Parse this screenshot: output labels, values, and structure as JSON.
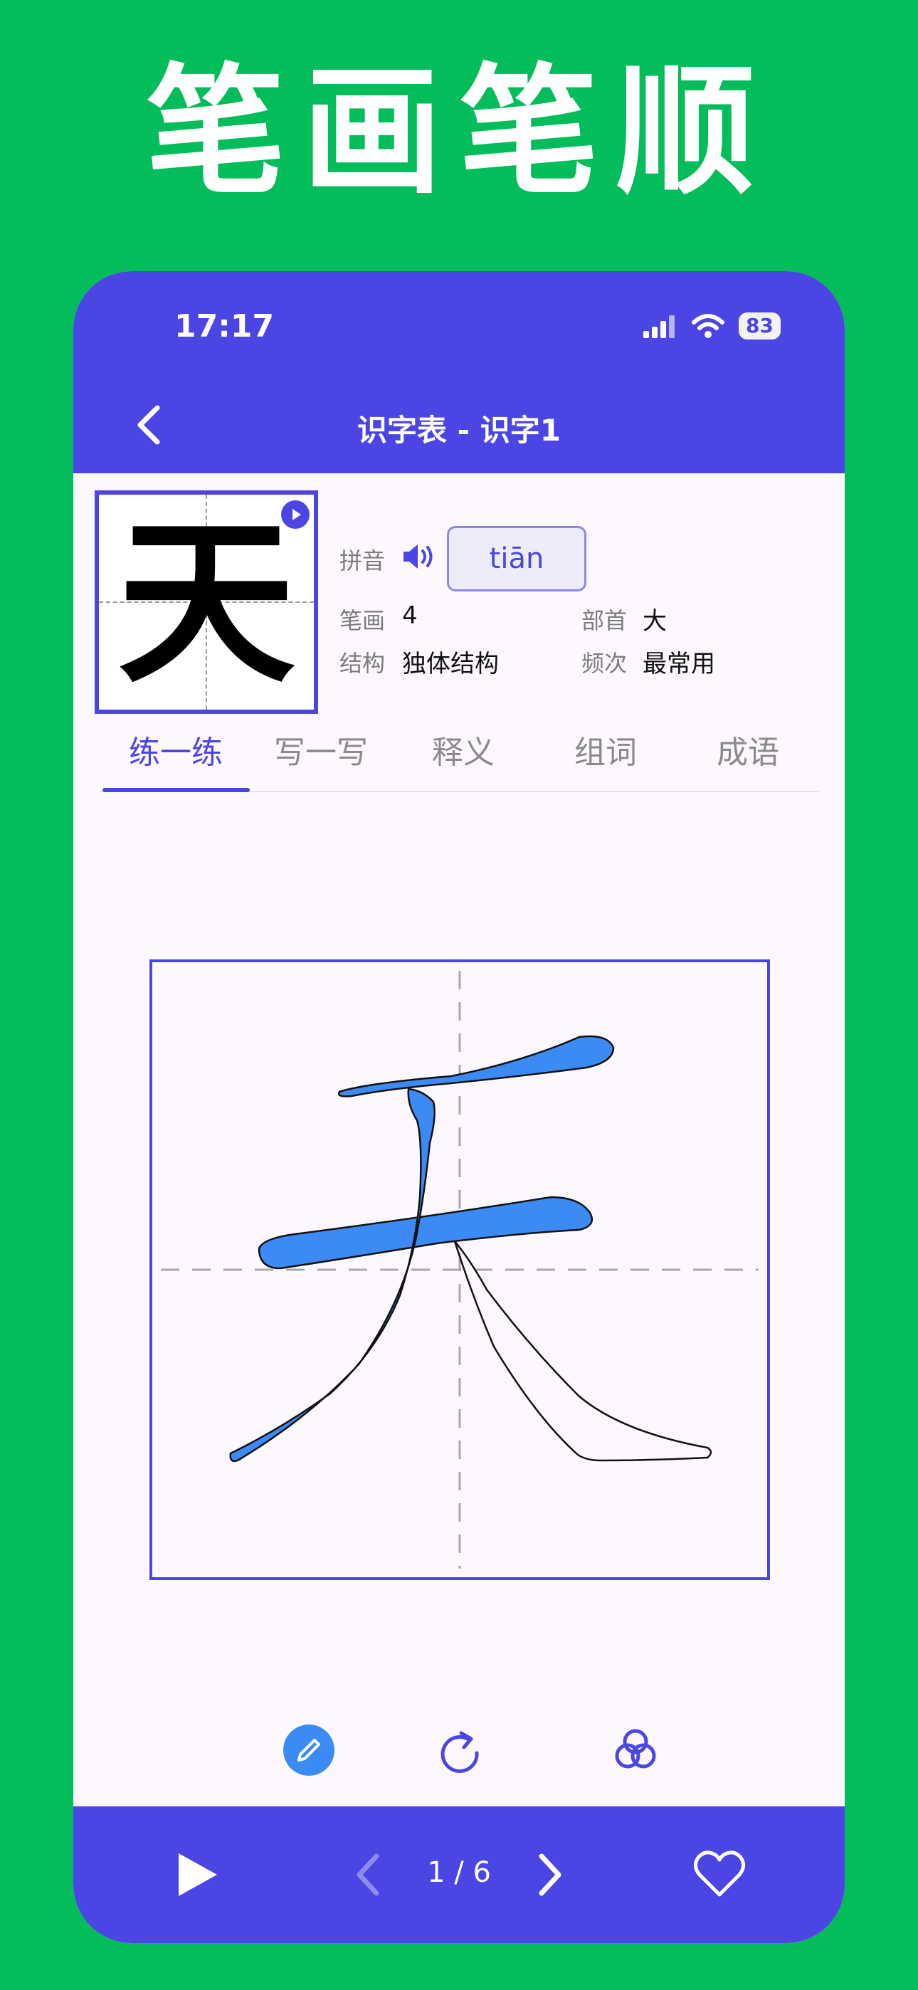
{
  "banner": {
    "title": "笔画笔顺"
  },
  "status_bar": {
    "time": "17:17",
    "battery": "83"
  },
  "nav": {
    "title": "识字表 - 识字1"
  },
  "character": {
    "glyph": "天",
    "pinyin_label": "拼音",
    "pinyin": "tiān",
    "strokes_label": "笔画",
    "strokes": "4",
    "radical_label": "部首",
    "radical": "大",
    "structure_label": "结构",
    "structure": "独体结构",
    "frequency_label": "频次",
    "frequency": "最常用"
  },
  "tabs": [
    {
      "label": "练一练"
    },
    {
      "label": "写一写"
    },
    {
      "label": "释义"
    },
    {
      "label": "组词"
    },
    {
      "label": "成语"
    }
  ],
  "active_tab": 0,
  "pager": {
    "text": "1 / 6"
  },
  "icons": {
    "back": "chevron-left-icon",
    "speaker": "speaker-icon",
    "play": "play-icon",
    "pen": "pencil-icon",
    "refresh": "refresh-icon",
    "layers": "circles-icon",
    "prev": "chevron-left-icon",
    "next": "chevron-right-icon",
    "favorite": "heart-icon"
  },
  "colors": {
    "background": "#03BD5B",
    "accent": "#4B45E3",
    "stroke_fill": "#3C8BF5",
    "paper": "#FCF8FE"
  }
}
